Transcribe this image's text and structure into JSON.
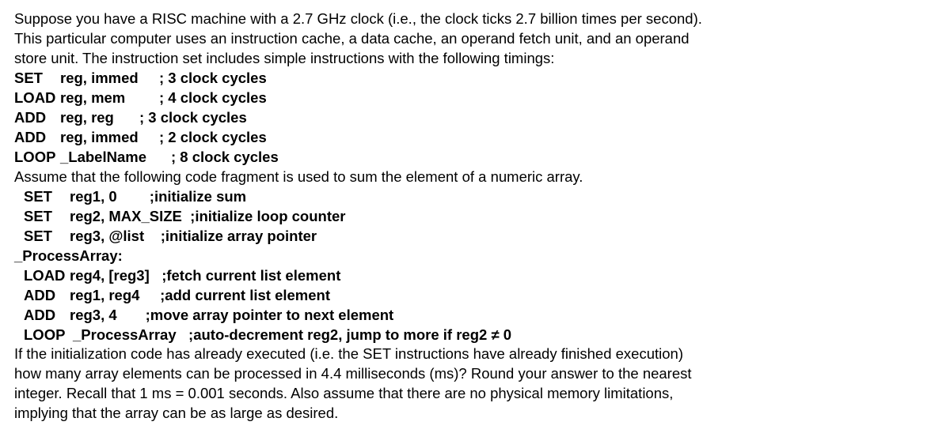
{
  "intro": {
    "line1": "Suppose you have a RISC machine with a 2.7 GHz clock (i.e., the clock ticks 2.7 billion times per second).",
    "line2": "This particular computer uses an instruction cache, a data cache, an operand fetch unit, and an operand",
    "line3": "store unit. The instruction set includes simple instructions with the following timings:"
  },
  "timings": [
    {
      "op": "SET",
      "args": "reg, immed",
      "cycles": "; 3 clock cycles"
    },
    {
      "op": "LOAD",
      "args": "reg, mem",
      "cycles": "; 4 clock cycles"
    },
    {
      "op": "ADD",
      "args": "reg, reg",
      "cycles": "; 3 clock cycles"
    },
    {
      "op": "ADD",
      "args": "reg, immed",
      "cycles": "; 2 clock cycles"
    },
    {
      "op": "LOOP",
      "args": "_LabelName",
      "cycles": "; 8 clock cycles"
    }
  ],
  "mid": "Assume that the following code fragment is used to sum the element of a numeric array.",
  "code_init": [
    {
      "op": "SET",
      "args": "reg1, 0",
      "comment": ";initialize sum"
    },
    {
      "op": "SET",
      "args": "reg2, MAX_SIZE",
      "comment": ";initialize loop counter"
    },
    {
      "op": "SET",
      "args": "reg3, @list",
      "comment": ";initialize array pointer"
    }
  ],
  "label": "_ProcessArray:",
  "code_loop": [
    {
      "op": "LOAD",
      "args": "reg4, [reg3]",
      "comment": ";fetch current list element"
    },
    {
      "op": "ADD",
      "args": "reg1, reg4",
      "comment": ";add current list element"
    },
    {
      "op": "ADD",
      "args": "reg3, 4",
      "comment": ";move array pointer to next element"
    },
    {
      "op": "LOOP",
      "args": "_ProcessArray",
      "comment": ";auto-decrement reg2, jump to more if reg2 ≠ 0"
    }
  ],
  "question": {
    "line1": "If the initialization code has already executed (i.e. the SET instructions have already finished execution)",
    "line2": "how many array elements can be processed in 4.4 milliseconds (ms)? Round your answer to the nearest",
    "line3": "integer. Recall that 1 ms = 0.001 seconds. Also assume that there are no physical memory limitations,",
    "line4": "implying that the array can be as large as desired."
  }
}
